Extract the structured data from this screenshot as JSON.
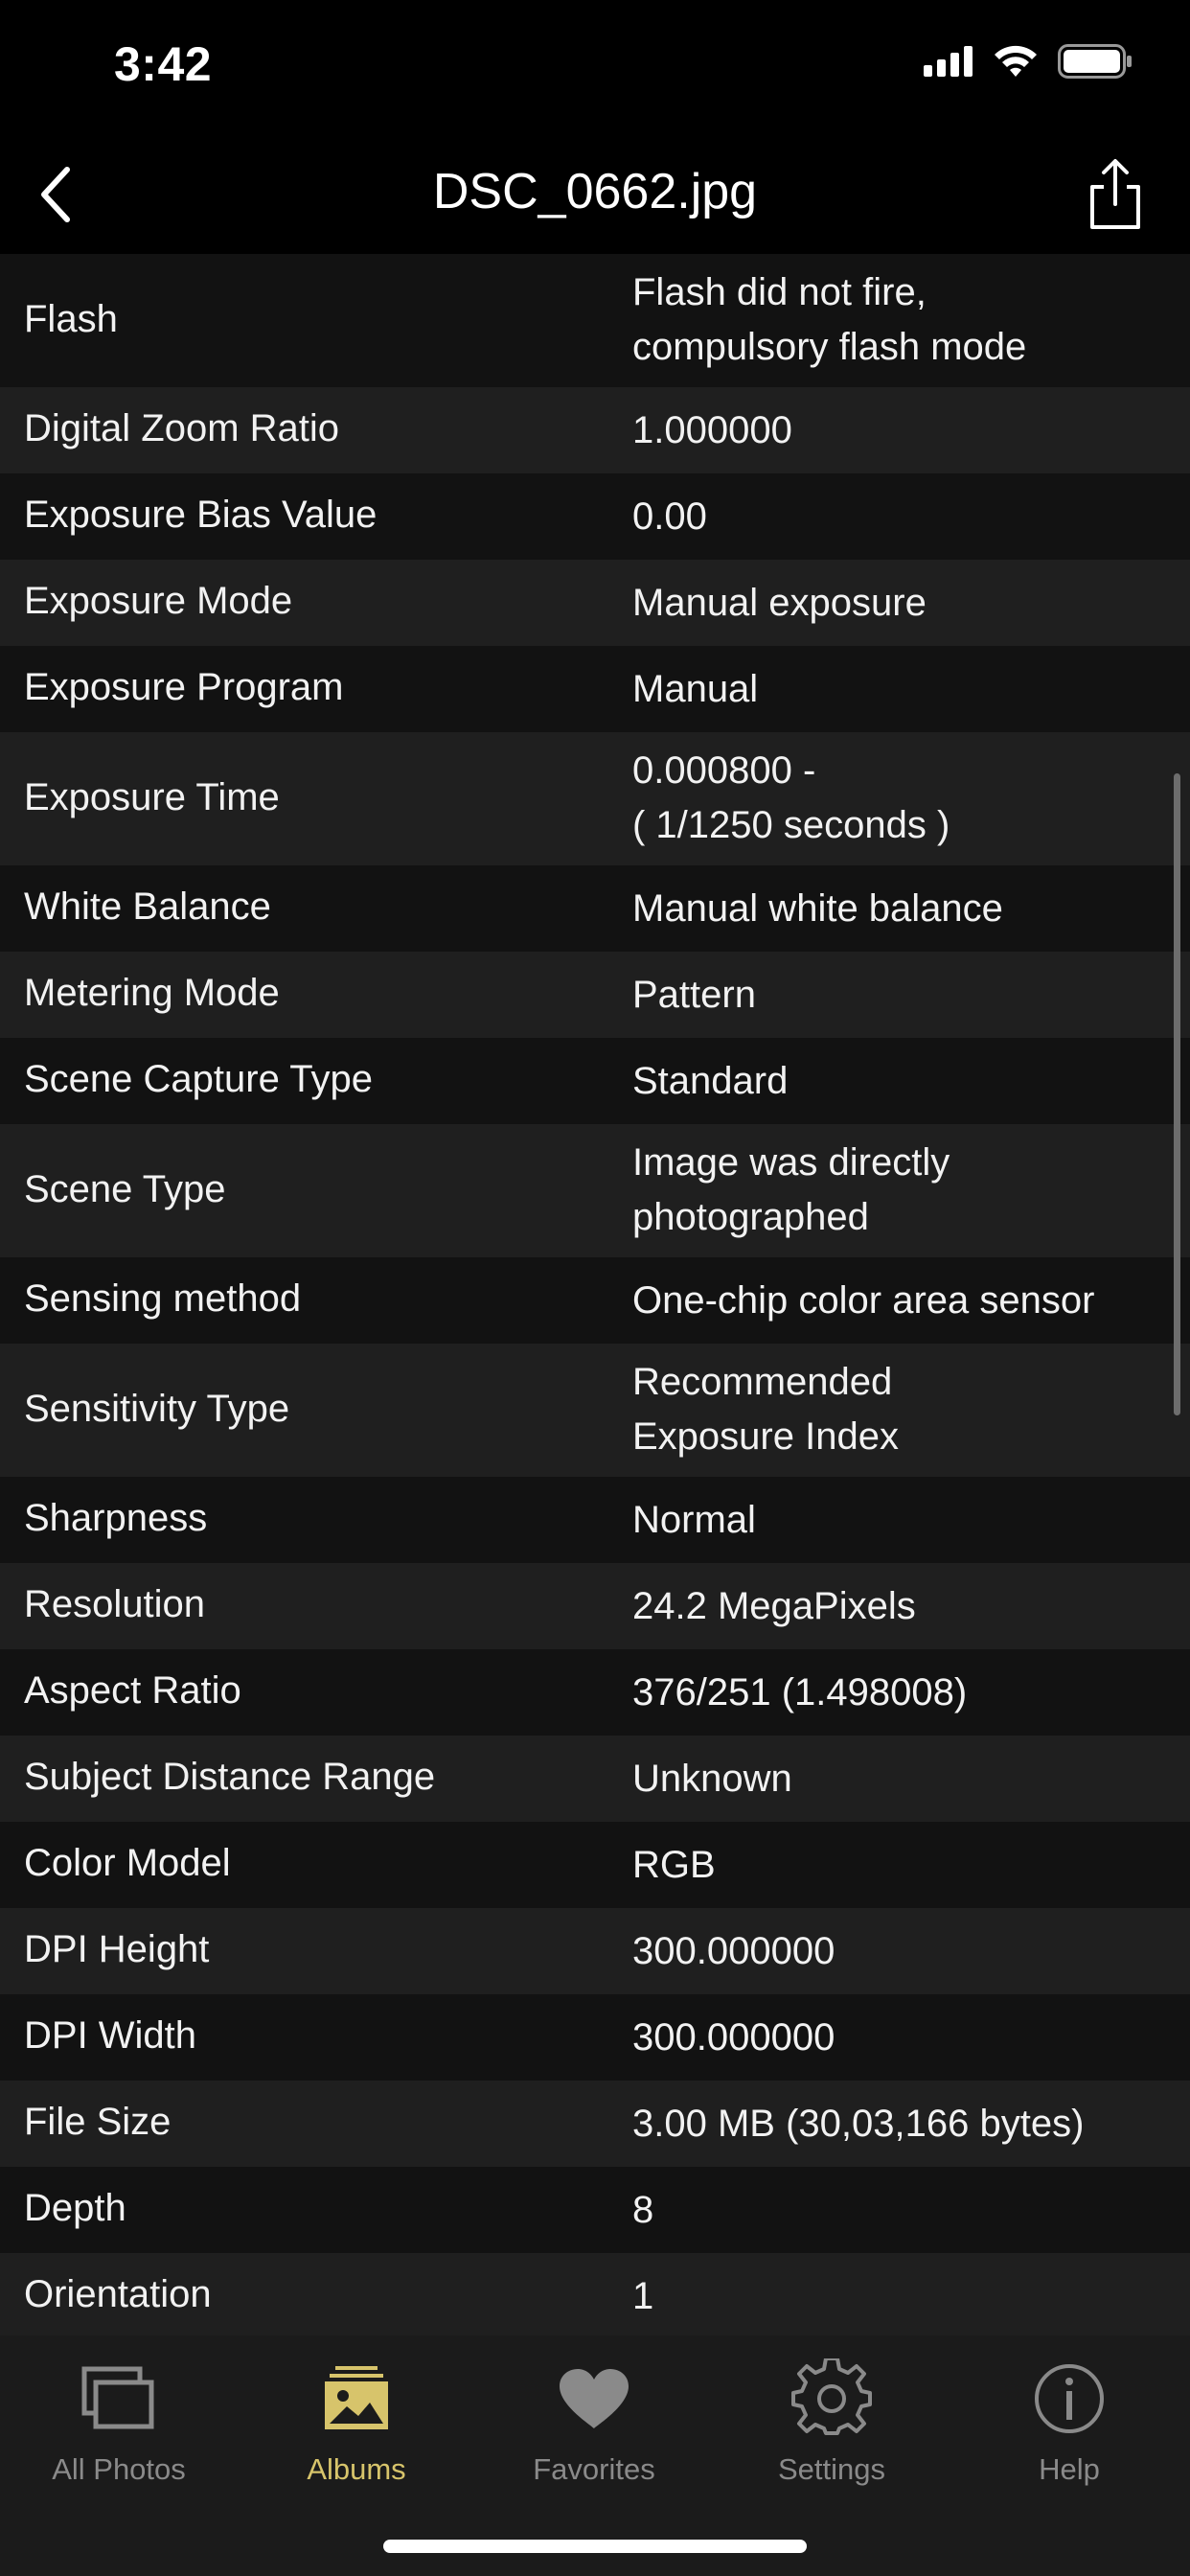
{
  "status": {
    "time": "3:42"
  },
  "nav": {
    "title": "DSC_0662.jpg"
  },
  "rows": [
    {
      "label": "Flash",
      "value": "Flash did not fire,\ncompulsory flash mode"
    },
    {
      "label": "Digital Zoom Ratio",
      "value": "1.000000"
    },
    {
      "label": "Exposure Bias Value",
      "value": "0.00"
    },
    {
      "label": "Exposure Mode",
      "value": "Manual exposure"
    },
    {
      "label": "Exposure Program",
      "value": "Manual"
    },
    {
      "label": "Exposure Time",
      "value": "0.000800 -\n( 1/1250 seconds )"
    },
    {
      "label": "White Balance",
      "value": "Manual white balance"
    },
    {
      "label": "Metering Mode",
      "value": "Pattern"
    },
    {
      "label": "Scene Capture Type",
      "value": "Standard"
    },
    {
      "label": "Scene Type",
      "value": "Image was directly\nphotographed"
    },
    {
      "label": "Sensing method",
      "value": "One-chip color area sensor"
    },
    {
      "label": "Sensitivity Type",
      "value": "Recommended\nExposure Index"
    },
    {
      "label": "Sharpness",
      "value": "Normal"
    },
    {
      "label": "Resolution",
      "value": "24.2 MegaPixels"
    },
    {
      "label": "Aspect Ratio",
      "value": "376/251 (1.498008)"
    },
    {
      "label": "Subject Distance Range",
      "value": "Unknown"
    },
    {
      "label": "Color Model",
      "value": "RGB"
    },
    {
      "label": "DPI Height",
      "value": "300.000000"
    },
    {
      "label": "DPI Width",
      "value": "300.000000"
    },
    {
      "label": "File Size",
      "value": "3.00 MB (30,03,166 bytes)"
    },
    {
      "label": "Depth",
      "value": "8"
    },
    {
      "label": "Orientation",
      "value": "1"
    }
  ],
  "tabs": [
    {
      "label": "All Photos",
      "icon": "photos-stack-icon",
      "active": false
    },
    {
      "label": "Albums",
      "icon": "album-image-icon",
      "active": true
    },
    {
      "label": "Favorites",
      "icon": "heart-icon",
      "active": false
    },
    {
      "label": "Settings",
      "icon": "gear-icon",
      "active": false
    },
    {
      "label": "Help",
      "icon": "info-icon",
      "active": false
    }
  ],
  "colors": {
    "accent": "#d7c46b",
    "inactive": "#8a8a8a",
    "row_odd": "#121212",
    "row_even": "#1f1f1f"
  }
}
